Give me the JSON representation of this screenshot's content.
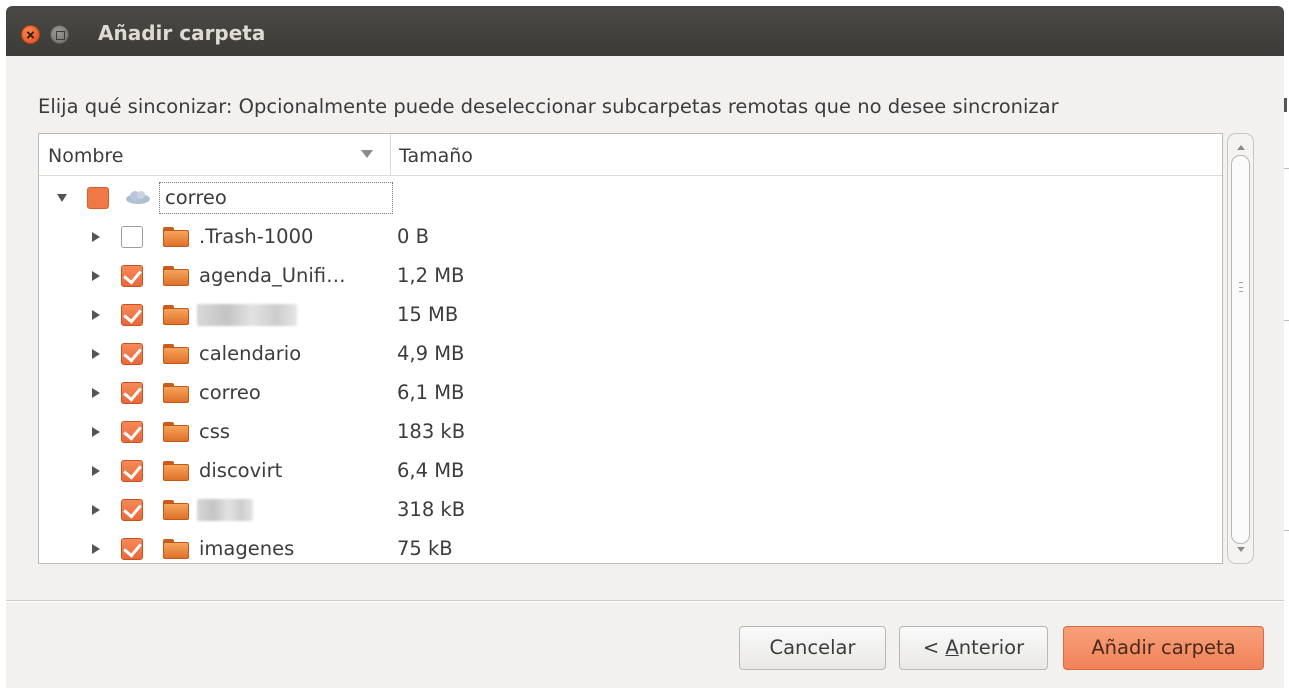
{
  "window": {
    "title": "Añadir carpeta"
  },
  "instructions": "Elija qué sinconizar: Opcionalmente puede deseleccionar subcarpetas remotas que no desee sincronizar",
  "tree": {
    "columns": {
      "name": "Nombre",
      "size": "Tamaño"
    },
    "root": {
      "name": "correo",
      "state": "partial",
      "expanded": true,
      "icon": "cloud-icon"
    },
    "items": [
      {
        "name": ".Trash-1000",
        "size": "0 B",
        "checked": false,
        "redacted": false
      },
      {
        "name": "agenda_Unifi…",
        "size": "1,2 MB",
        "checked": true,
        "redacted": false
      },
      {
        "name": "",
        "size": "15 MB",
        "checked": true,
        "redacted": true
      },
      {
        "name": "calendario",
        "size": "4,9 MB",
        "checked": true,
        "redacted": false
      },
      {
        "name": "correo",
        "size": "6,1 MB",
        "checked": true,
        "redacted": false
      },
      {
        "name": "css",
        "size": "183 kB",
        "checked": true,
        "redacted": false
      },
      {
        "name": "discovirt",
        "size": "6,4 MB",
        "checked": true,
        "redacted": false
      },
      {
        "name": "",
        "size": "318 kB",
        "checked": true,
        "redacted": true
      },
      {
        "name": "imagenes",
        "size": "75 kB",
        "checked": true,
        "redacted": false
      }
    ]
  },
  "buttons": {
    "cancel": "Cancelar",
    "prev_prefix": "< ",
    "prev_mnemonic": "A",
    "prev_rest": "nterior",
    "add": "Añadir carpeta"
  },
  "colors": {
    "accent": "#f07746",
    "titlebar": "#3c3b37",
    "folder": "#e8823a"
  }
}
